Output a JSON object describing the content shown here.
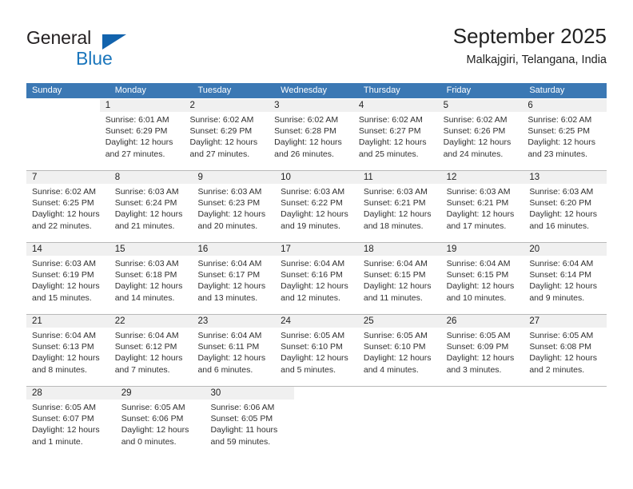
{
  "brand": {
    "name_part1": "General",
    "name_part2": "Blue",
    "triangle_color": "#1263ad",
    "blue_color": "#1b76bc"
  },
  "header": {
    "title": "September 2025",
    "subtitle": "Malkajgiri, Telangana, India"
  },
  "theme": {
    "header_bg": "#3b78b4",
    "daynum_band": "#f0f0f0",
    "week_separator": "#b9b9b9",
    "text": "#303030"
  },
  "weekdays": [
    "Sunday",
    "Monday",
    "Tuesday",
    "Wednesday",
    "Thursday",
    "Friday",
    "Saturday"
  ],
  "weeks": [
    [
      {
        "empty": true
      },
      {
        "day": "1",
        "sunrise": "Sunrise: 6:01 AM",
        "sunset": "Sunset: 6:29 PM",
        "daylight1": "Daylight: 12 hours",
        "daylight2": "and 27 minutes."
      },
      {
        "day": "2",
        "sunrise": "Sunrise: 6:02 AM",
        "sunset": "Sunset: 6:29 PM",
        "daylight1": "Daylight: 12 hours",
        "daylight2": "and 27 minutes."
      },
      {
        "day": "3",
        "sunrise": "Sunrise: 6:02 AM",
        "sunset": "Sunset: 6:28 PM",
        "daylight1": "Daylight: 12 hours",
        "daylight2": "and 26 minutes."
      },
      {
        "day": "4",
        "sunrise": "Sunrise: 6:02 AM",
        "sunset": "Sunset: 6:27 PM",
        "daylight1": "Daylight: 12 hours",
        "daylight2": "and 25 minutes."
      },
      {
        "day": "5",
        "sunrise": "Sunrise: 6:02 AM",
        "sunset": "Sunset: 6:26 PM",
        "daylight1": "Daylight: 12 hours",
        "daylight2": "and 24 minutes."
      },
      {
        "day": "6",
        "sunrise": "Sunrise: 6:02 AM",
        "sunset": "Sunset: 6:25 PM",
        "daylight1": "Daylight: 12 hours",
        "daylight2": "and 23 minutes."
      }
    ],
    [
      {
        "day": "7",
        "sunrise": "Sunrise: 6:02 AM",
        "sunset": "Sunset: 6:25 PM",
        "daylight1": "Daylight: 12 hours",
        "daylight2": "and 22 minutes."
      },
      {
        "day": "8",
        "sunrise": "Sunrise: 6:03 AM",
        "sunset": "Sunset: 6:24 PM",
        "daylight1": "Daylight: 12 hours",
        "daylight2": "and 21 minutes."
      },
      {
        "day": "9",
        "sunrise": "Sunrise: 6:03 AM",
        "sunset": "Sunset: 6:23 PM",
        "daylight1": "Daylight: 12 hours",
        "daylight2": "and 20 minutes."
      },
      {
        "day": "10",
        "sunrise": "Sunrise: 6:03 AM",
        "sunset": "Sunset: 6:22 PM",
        "daylight1": "Daylight: 12 hours",
        "daylight2": "and 19 minutes."
      },
      {
        "day": "11",
        "sunrise": "Sunrise: 6:03 AM",
        "sunset": "Sunset: 6:21 PM",
        "daylight1": "Daylight: 12 hours",
        "daylight2": "and 18 minutes."
      },
      {
        "day": "12",
        "sunrise": "Sunrise: 6:03 AM",
        "sunset": "Sunset: 6:21 PM",
        "daylight1": "Daylight: 12 hours",
        "daylight2": "and 17 minutes."
      },
      {
        "day": "13",
        "sunrise": "Sunrise: 6:03 AM",
        "sunset": "Sunset: 6:20 PM",
        "daylight1": "Daylight: 12 hours",
        "daylight2": "and 16 minutes."
      }
    ],
    [
      {
        "day": "14",
        "sunrise": "Sunrise: 6:03 AM",
        "sunset": "Sunset: 6:19 PM",
        "daylight1": "Daylight: 12 hours",
        "daylight2": "and 15 minutes."
      },
      {
        "day": "15",
        "sunrise": "Sunrise: 6:03 AM",
        "sunset": "Sunset: 6:18 PM",
        "daylight1": "Daylight: 12 hours",
        "daylight2": "and 14 minutes."
      },
      {
        "day": "16",
        "sunrise": "Sunrise: 6:04 AM",
        "sunset": "Sunset: 6:17 PM",
        "daylight1": "Daylight: 12 hours",
        "daylight2": "and 13 minutes."
      },
      {
        "day": "17",
        "sunrise": "Sunrise: 6:04 AM",
        "sunset": "Sunset: 6:16 PM",
        "daylight1": "Daylight: 12 hours",
        "daylight2": "and 12 minutes."
      },
      {
        "day": "18",
        "sunrise": "Sunrise: 6:04 AM",
        "sunset": "Sunset: 6:15 PM",
        "daylight1": "Daylight: 12 hours",
        "daylight2": "and 11 minutes."
      },
      {
        "day": "19",
        "sunrise": "Sunrise: 6:04 AM",
        "sunset": "Sunset: 6:15 PM",
        "daylight1": "Daylight: 12 hours",
        "daylight2": "and 10 minutes."
      },
      {
        "day": "20",
        "sunrise": "Sunrise: 6:04 AM",
        "sunset": "Sunset: 6:14 PM",
        "daylight1": "Daylight: 12 hours",
        "daylight2": "and 9 minutes."
      }
    ],
    [
      {
        "day": "21",
        "sunrise": "Sunrise: 6:04 AM",
        "sunset": "Sunset: 6:13 PM",
        "daylight1": "Daylight: 12 hours",
        "daylight2": "and 8 minutes."
      },
      {
        "day": "22",
        "sunrise": "Sunrise: 6:04 AM",
        "sunset": "Sunset: 6:12 PM",
        "daylight1": "Daylight: 12 hours",
        "daylight2": "and 7 minutes."
      },
      {
        "day": "23",
        "sunrise": "Sunrise: 6:04 AM",
        "sunset": "Sunset: 6:11 PM",
        "daylight1": "Daylight: 12 hours",
        "daylight2": "and 6 minutes."
      },
      {
        "day": "24",
        "sunrise": "Sunrise: 6:05 AM",
        "sunset": "Sunset: 6:10 PM",
        "daylight1": "Daylight: 12 hours",
        "daylight2": "and 5 minutes."
      },
      {
        "day": "25",
        "sunrise": "Sunrise: 6:05 AM",
        "sunset": "Sunset: 6:10 PM",
        "daylight1": "Daylight: 12 hours",
        "daylight2": "and 4 minutes."
      },
      {
        "day": "26",
        "sunrise": "Sunrise: 6:05 AM",
        "sunset": "Sunset: 6:09 PM",
        "daylight1": "Daylight: 12 hours",
        "daylight2": "and 3 minutes."
      },
      {
        "day": "27",
        "sunrise": "Sunrise: 6:05 AM",
        "sunset": "Sunset: 6:08 PM",
        "daylight1": "Daylight: 12 hours",
        "daylight2": "and 2 minutes."
      }
    ],
    [
      {
        "day": "28",
        "sunrise": "Sunrise: 6:05 AM",
        "sunset": "Sunset: 6:07 PM",
        "daylight1": "Daylight: 12 hours",
        "daylight2": "and 1 minute."
      },
      {
        "day": "29",
        "sunrise": "Sunrise: 6:05 AM",
        "sunset": "Sunset: 6:06 PM",
        "daylight1": "Daylight: 12 hours",
        "daylight2": "and 0 minutes."
      },
      {
        "day": "30",
        "sunrise": "Sunrise: 6:06 AM",
        "sunset": "Sunset: 6:05 PM",
        "daylight1": "Daylight: 11 hours",
        "daylight2": "and 59 minutes."
      },
      {
        "empty": true
      },
      {
        "empty": true
      },
      {
        "empty": true
      },
      {
        "empty": true
      }
    ]
  ]
}
